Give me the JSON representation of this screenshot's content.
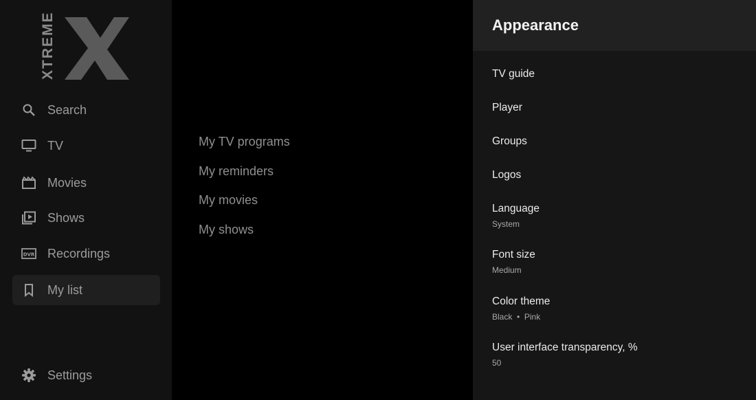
{
  "logo": {
    "text": "XTREME",
    "icon": "x-logo-icon"
  },
  "sidebar": {
    "items": [
      {
        "label": "Search",
        "icon": "search-icon"
      },
      {
        "label": "TV",
        "icon": "tv-icon"
      },
      {
        "label": "Movies",
        "icon": "movies-icon"
      },
      {
        "label": "Shows",
        "icon": "shows-icon"
      },
      {
        "label": "Recordings",
        "icon": "dvr-icon"
      },
      {
        "label": "My list",
        "icon": "bookmark-icon",
        "active": true
      }
    ],
    "settings": {
      "label": "Settings",
      "icon": "gear-icon"
    }
  },
  "mylist": {
    "items": [
      "My TV programs",
      "My reminders",
      "My movies",
      "My shows"
    ]
  },
  "panel": {
    "title": "Appearance",
    "options": [
      {
        "label": "TV guide"
      },
      {
        "label": "Player"
      },
      {
        "label": "Groups"
      },
      {
        "label": "Logos"
      },
      {
        "label": "Language",
        "value": "System"
      },
      {
        "label": "Font size",
        "value": "Medium"
      },
      {
        "label": "Color theme",
        "value": "Black  •  Pink"
      },
      {
        "label": "User interface transparency, %",
        "value": "50"
      }
    ]
  }
}
